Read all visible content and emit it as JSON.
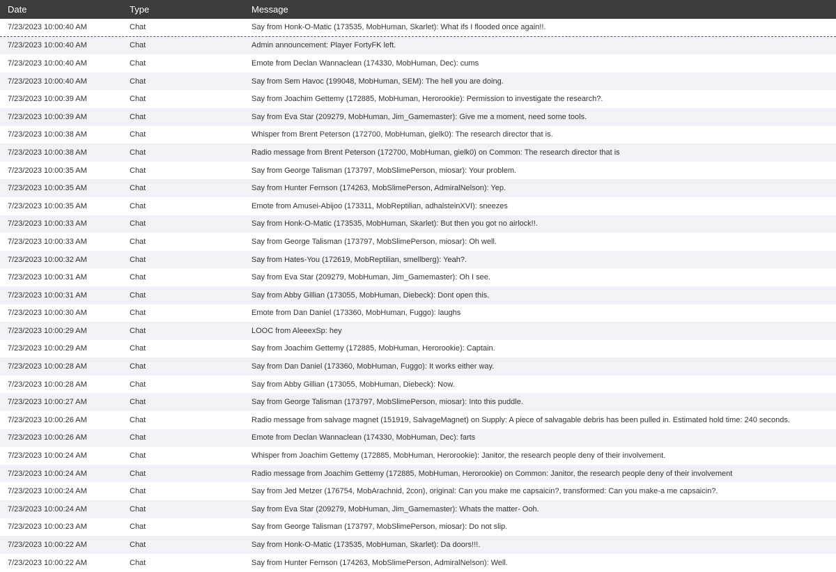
{
  "header": {
    "date": "Date",
    "type": "Type",
    "message": "Message"
  },
  "rows": [
    {
      "date": "7/23/2023 10:00:40 AM",
      "type": "Chat",
      "message": "Say from Honk-O-Matic (173535, MobHuman, Skarlet): What ifs I flooded once again!!.",
      "focused": true
    },
    {
      "date": "7/23/2023 10:00:40 AM",
      "type": "Chat",
      "message": "Admin announcement: Player FortyFK left."
    },
    {
      "date": "7/23/2023 10:00:40 AM",
      "type": "Chat",
      "message": "Emote from Declan Wannaclean (174330, MobHuman, Dec): cums",
      "underlined": true
    },
    {
      "date": "7/23/2023 10:00:40 AM",
      "type": "Chat",
      "message": "Say from Sem Havoc (199048, MobHuman, SEM): The hell you are doing."
    },
    {
      "date": "7/23/2023 10:00:39 AM",
      "type": "Chat",
      "message": "Say from Joachim Gettemy (172885, MobHuman, Herorookie): Permission to investigate the research?."
    },
    {
      "date": "7/23/2023 10:00:39 AM",
      "type": "Chat",
      "message": "Say from Eva Star (209279, MobHuman, Jim_Gamemaster): Give me a moment, need some tools."
    },
    {
      "date": "7/23/2023 10:00:38 AM",
      "type": "Chat",
      "message": "Whisper from Brent Peterson (172700, MobHuman, gielk0): The research director that is."
    },
    {
      "date": "7/23/2023 10:00:38 AM",
      "type": "Chat",
      "message": "Radio message from Brent Peterson (172700, MobHuman, gielk0) on Common: The research director that is"
    },
    {
      "date": "7/23/2023 10:00:35 AM",
      "type": "Chat",
      "message": "Say from George Talisman (173797, MobSlimePerson, miosar): Your problem."
    },
    {
      "date": "7/23/2023 10:00:35 AM",
      "type": "Chat",
      "message": "Say from Hunter Fernson (174263, MobSlimePerson, AdmiralNelson): Yep."
    },
    {
      "date": "7/23/2023 10:00:35 AM",
      "type": "Chat",
      "message": "Emote from Amusei-Abijoo (173311, MobReptilian, adhalsteinXVI): sneezes"
    },
    {
      "date": "7/23/2023 10:00:33 AM",
      "type": "Chat",
      "message": "Say from Honk-O-Matic (173535, MobHuman, Skarlet): But then you got no airlock!!."
    },
    {
      "date": "7/23/2023 10:00:33 AM",
      "type": "Chat",
      "message": "Say from George Talisman (173797, MobSlimePerson, miosar): Oh well."
    },
    {
      "date": "7/23/2023 10:00:32 AM",
      "type": "Chat",
      "message": "Say from Hates-You (172619, MobReptilian, smellberg): Yeah?."
    },
    {
      "date": "7/23/2023 10:00:31 AM",
      "type": "Chat",
      "message": "Say from Eva Star (209279, MobHuman, Jim_Gamemaster): Oh I see."
    },
    {
      "date": "7/23/2023 10:00:31 AM",
      "type": "Chat",
      "message": "Say from Abby Gillian (173055, MobHuman, Diebeck): Dont open this."
    },
    {
      "date": "7/23/2023 10:00:30 AM",
      "type": "Chat",
      "message": "Emote from Dan Daniel (173360, MobHuman, Fuggo): laughs"
    },
    {
      "date": "7/23/2023 10:00:29 AM",
      "type": "Chat",
      "message": "LOOC from AleeexSp: hey"
    },
    {
      "date": "7/23/2023 10:00:29 AM",
      "type": "Chat",
      "message": "Say from Joachim Gettemy (172885, MobHuman, Herorookie): Captain."
    },
    {
      "date": "7/23/2023 10:00:28 AM",
      "type": "Chat",
      "message": "Say from Dan Daniel (173360, MobHuman, Fuggo): It works either way."
    },
    {
      "date": "7/23/2023 10:00:28 AM",
      "type": "Chat",
      "message": "Say from Abby Gillian (173055, MobHuman, Diebeck): Now."
    },
    {
      "date": "7/23/2023 10:00:27 AM",
      "type": "Chat",
      "message": "Say from George Talisman (173797, MobSlimePerson, miosar): Into this puddle."
    },
    {
      "date": "7/23/2023 10:00:26 AM",
      "type": "Chat",
      "message": "Radio message from salvage magnet (151919, SalvageMagnet) on Supply: A piece of salvagable debris has been pulled in. Estimated hold time: 240 seconds."
    },
    {
      "date": "7/23/2023 10:00:26 AM",
      "type": "Chat",
      "message": "Emote from Declan Wannaclean (174330, MobHuman, Dec): farts",
      "underlined": true
    },
    {
      "date": "7/23/2023 10:00:24 AM",
      "type": "Chat",
      "message": "Whisper from Joachim Gettemy (172885, MobHuman, Herorookie): Janitor, the research people deny of their involvement."
    },
    {
      "date": "7/23/2023 10:00:24 AM",
      "type": "Chat",
      "message": "Radio message from Joachim Gettemy (172885, MobHuman, Herorookie) on Common: Janitor, the research people deny of their involvement"
    },
    {
      "date": "7/23/2023 10:00:24 AM",
      "type": "Chat",
      "message": "Say from Jed Metzer (176754, MobArachnid, 2con), original: Can you make me capsaicin?, transformed: Can you make-a me capsaicin?."
    },
    {
      "date": "7/23/2023 10:00:24 AM",
      "type": "Chat",
      "message": "Say from Eva Star (209279, MobHuman, Jim_Gamemaster): Whats the matter- Ooh."
    },
    {
      "date": "7/23/2023 10:00:23 AM",
      "type": "Chat",
      "message": "Say from George Talisman (173797, MobSlimePerson, miosar): Do not slip."
    },
    {
      "date": "7/23/2023 10:00:22 AM",
      "type": "Chat",
      "message": "Say from Honk-O-Matic (173535, MobHuman, Skarlet): Da doors!!!."
    },
    {
      "date": "7/23/2023 10:00:22 AM",
      "type": "Chat",
      "message": "Say from Hunter Fernson (174263, MobSlimePerson, AdmiralNelson): Well."
    }
  ],
  "colors": {
    "header_bg": "#3c3c3c",
    "header_text": "#ffffff",
    "row_alt_bg": "#f1f1f7",
    "text": "#333333",
    "annotation": "#d0242b"
  }
}
